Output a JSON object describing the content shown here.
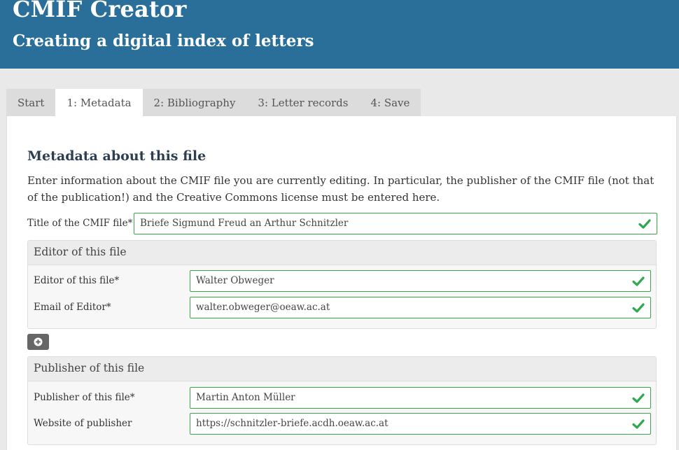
{
  "header": {
    "title": "CMIF Creator",
    "subtitle": "Creating a digital index of letters"
  },
  "tabs": [
    {
      "label": "Start",
      "active": false
    },
    {
      "label": "1: Metadata",
      "active": true
    },
    {
      "label": "2: Bibliography",
      "active": false
    },
    {
      "label": "3: Letter records",
      "active": false
    },
    {
      "label": "4: Save",
      "active": false
    }
  ],
  "main": {
    "section_title": "Metadata about this file",
    "intro": "Enter information about the CMIF file you are currently editing. In particular, the publisher of the CMIF file (not that of the publication!) and the Creative Commons license must be entered here.",
    "title_field": {
      "label": "Title of the CMIF file*",
      "value": "Briefe Sigmund Freud an Arthur Schnitzler"
    },
    "editor_panel": {
      "heading": "Editor of this file",
      "editor_label": "Editor of this file*",
      "editor_value": "Walter Obweger",
      "email_label": "Email of Editor*",
      "email_value": "walter.obweger@oeaw.ac.at"
    },
    "publisher_panel": {
      "heading": "Publisher of this file",
      "publisher_label": "Publisher of this file*",
      "publisher_value": "Martin Anton Müller",
      "website_label": "Website of publisher",
      "website_value": "https://schnitzler-briefe.acdh.oeaw.ac.at"
    }
  },
  "icons": {
    "valid": "check-icon",
    "add": "plus-circle-icon"
  },
  "colors": {
    "header_bg": "#2a6f99",
    "valid_border": "#3aa64a",
    "check": "#2fa84f"
  }
}
